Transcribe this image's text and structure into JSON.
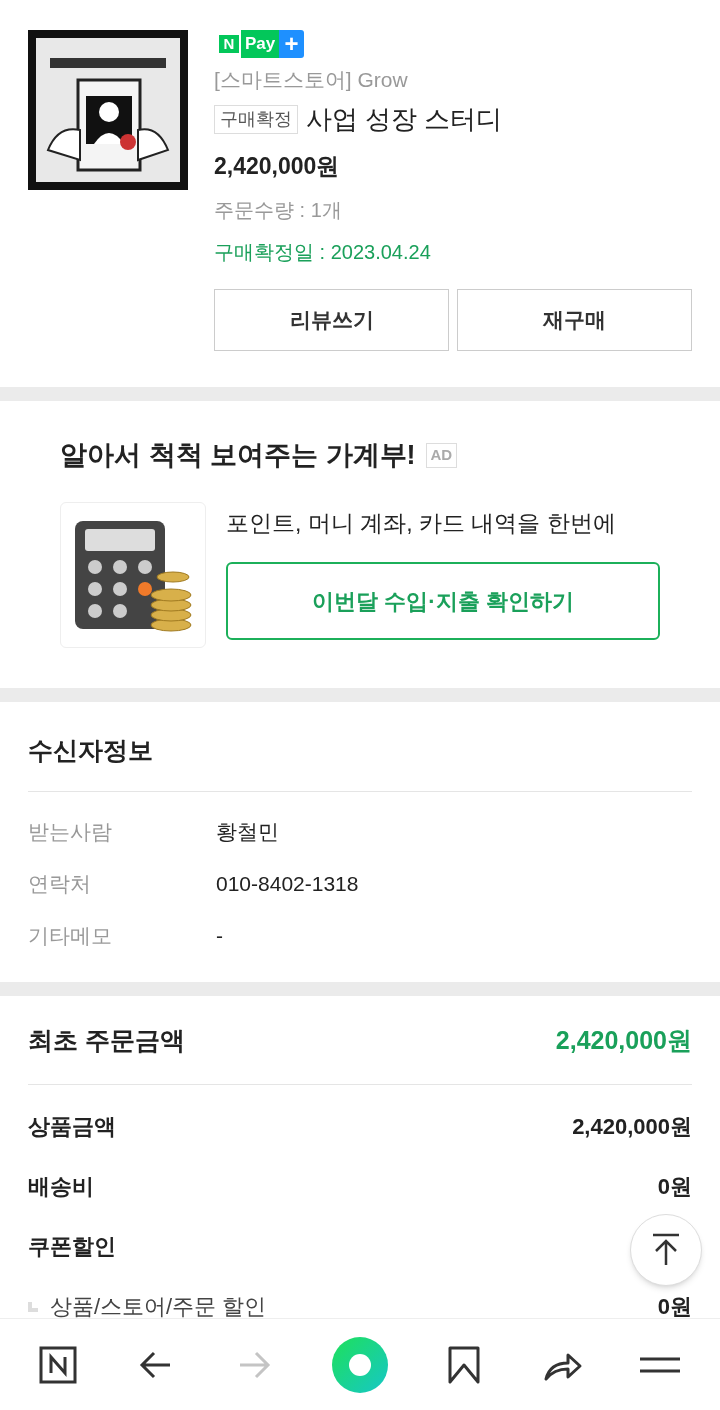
{
  "product": {
    "badge": {
      "n": "N",
      "pay": "Pay",
      "plus": "+"
    },
    "store": "[스마트스토어] Grow",
    "status": "구매확정",
    "name": "사업 성장 스터디",
    "price": "2,420,000원",
    "quantity": "주문수량 : 1개",
    "confirmed_date": "구매확정일 : 2023.04.24",
    "buttons": [
      "리뷰쓰기",
      "재구매"
    ]
  },
  "ad": {
    "title": "알아서 척척 보여주는 가계부!",
    "tag": "AD",
    "text": "포인트, 머니 계좌, 카드 내역을 한번에",
    "button": "이번달 수입·지출 확인하기"
  },
  "recipient": {
    "title": "수신자정보",
    "rows": [
      {
        "label": "받는사람",
        "value": "황철민"
      },
      {
        "label": "연락처",
        "value": "010-8402-1318"
      },
      {
        "label": "기타메모",
        "value": "-"
      }
    ]
  },
  "amounts": {
    "title": "최초 주문금액",
    "total": "2,420,000원",
    "rows": [
      {
        "kind": "main",
        "label": "상품금액",
        "value": "2,420,000원"
      },
      {
        "kind": "main",
        "label": "배송비",
        "value": "0원"
      },
      {
        "kind": "main",
        "label": "쿠폰할인"
      },
      {
        "kind": "sub",
        "label": "상품/스토어/주문 할인",
        "value": "0원"
      }
    ]
  },
  "bottom_nav": [
    {
      "kind": "naver",
      "disabled": false
    },
    {
      "kind": "back",
      "disabled": false
    },
    {
      "kind": "forward",
      "disabled": true
    },
    {
      "kind": "home",
      "disabled": false
    },
    {
      "kind": "bookmark",
      "disabled": false
    },
    {
      "kind": "share",
      "disabled": false
    },
    {
      "kind": "menu",
      "disabled": false
    }
  ]
}
